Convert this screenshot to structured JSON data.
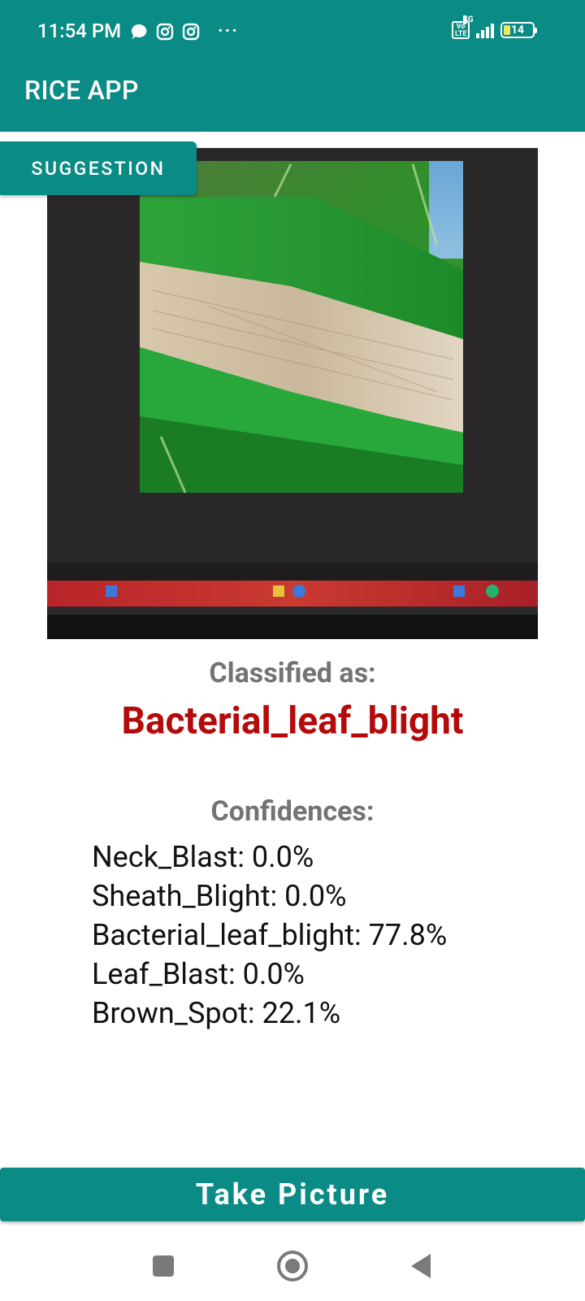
{
  "status_bar": {
    "time": "11:54 PM",
    "more": "···",
    "volte": "Vo LTE",
    "network": "4G",
    "battery_level": "14"
  },
  "app_bar": {
    "title": "RICE APP"
  },
  "suggestion_button": {
    "label": "SUGGESTION"
  },
  "result": {
    "classified_label": "Classified as:",
    "classified_value": "Bacterial_leaf_blight",
    "confidences_label": "Confidences:",
    "confidences": [
      "Neck_Blast: 0.0%",
      "Sheath_Blight: 0.0%",
      "Bacterial_leaf_blight: 77.8%",
      "Leaf_Blast: 0.0%",
      "Brown_Spot: 22.1%"
    ]
  },
  "take_picture_button": {
    "label": "Take Picture"
  },
  "colors": {
    "primary": "#0a8b85",
    "result": "#b50a0a",
    "label_gray": "#737373"
  }
}
